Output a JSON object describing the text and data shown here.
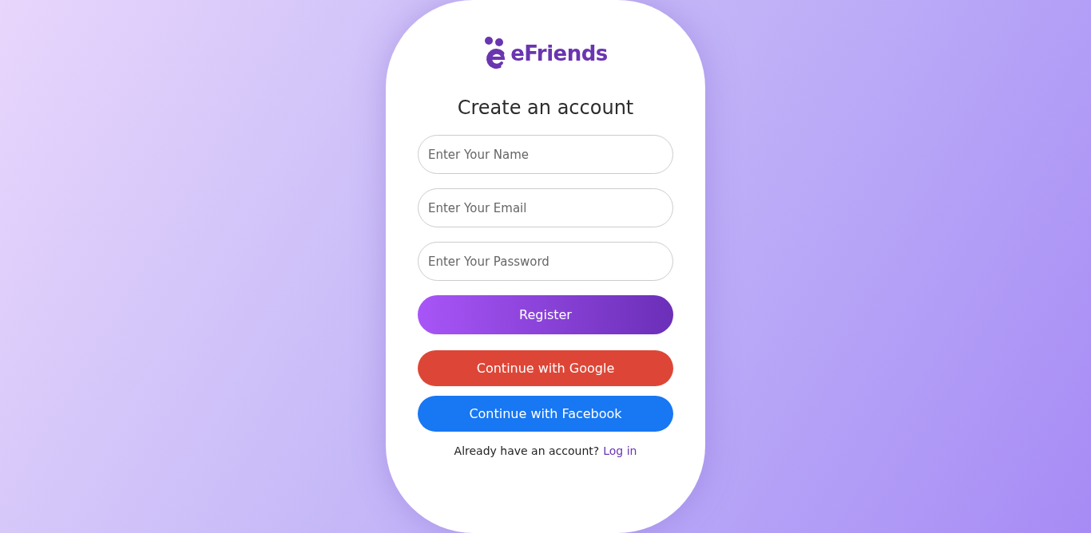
{
  "logo": {
    "text": "eFriends"
  },
  "title": "Create an account",
  "fields": [
    {
      "placeholder": "Enter Your Name"
    },
    {
      "placeholder": "Enter Your Email"
    },
    {
      "placeholder": "Enter Your Password"
    }
  ],
  "buttons": [
    {
      "kind": "primary",
      "label": "Register"
    },
    {
      "kind": "google",
      "label": "Continue with Google"
    },
    {
      "kind": "facebook",
      "label": "Continue with Facebook"
    }
  ],
  "footer": {
    "text": "Already have an account?",
    "link": "Log in"
  }
}
